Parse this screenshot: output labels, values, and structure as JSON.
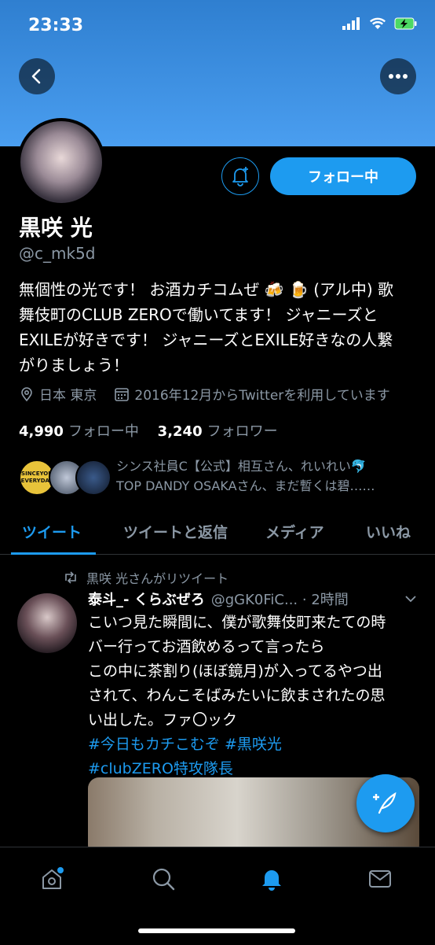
{
  "status_bar": {
    "time": "23:33"
  },
  "header": {
    "back_icon": "chevron-left-icon",
    "more_icon": "more-icon"
  },
  "profile": {
    "name": "黒咲 光",
    "handle": "@c_mk5d",
    "follow_button": "フォロー中",
    "bio_line1": "無個性の光です！ お酒カチコムぜ 🍻 🍺 (アル中) 歌",
    "bio_line2": "舞伎町のCLUB ZEROで働いてます！ ジャニーズと",
    "bio_line3": "EXILEが好きです！ ジャニーズとEXILE好きなの人繋",
    "bio_line4": "がりましょう！",
    "location": "日本 東京",
    "joined": "2016年12月からTwitterを利用しています",
    "following_count": "4,990",
    "following_label": "フォロー中",
    "followers_count": "3,240",
    "followers_label": "フォロワー",
    "followed_by_line1": "シンス社員C【公式】相互さん、れいれい🐬",
    "followed_by_line2": "TOP DANDY OSAKAさん、まだ暫くは碧……",
    "fav_logo_line1": "SINCEYOU",
    "fav_logo_line2": "EVERYDAY"
  },
  "tabs": [
    {
      "label": "ツイート"
    },
    {
      "label": "ツイートと返信"
    },
    {
      "label": "メディア"
    },
    {
      "label": "いいね"
    }
  ],
  "tweet": {
    "retweet_label": "黒咲 光さんがリツイート",
    "user_name": "泰斗_- くらぶぜろ",
    "user_handle": "@gGK0FiC... · 2時間",
    "line1": "こいつ見た瞬間に、僕が歌舞伎町来たての時",
    "line2": "バー行ってお酒飲めるって言ったら",
    "line3": "この中に茶割り(ほぼ鏡月)が入ってるやつ出",
    "line4": "されて、わんこそばみたいに飲まされたの思",
    "line5": "い出した。ファ〇ック",
    "hashtag1": "#今日もカチこむぞ #黒咲光",
    "hashtag2": "#clubZERO特攻隊長"
  },
  "bottom_nav": [
    "home-icon",
    "search-icon",
    "notifications-icon",
    "messages-icon"
  ],
  "colors": {
    "accent": "#1d9bf0",
    "banner": "#4a9ef0",
    "muted": "#8b98a5"
  }
}
